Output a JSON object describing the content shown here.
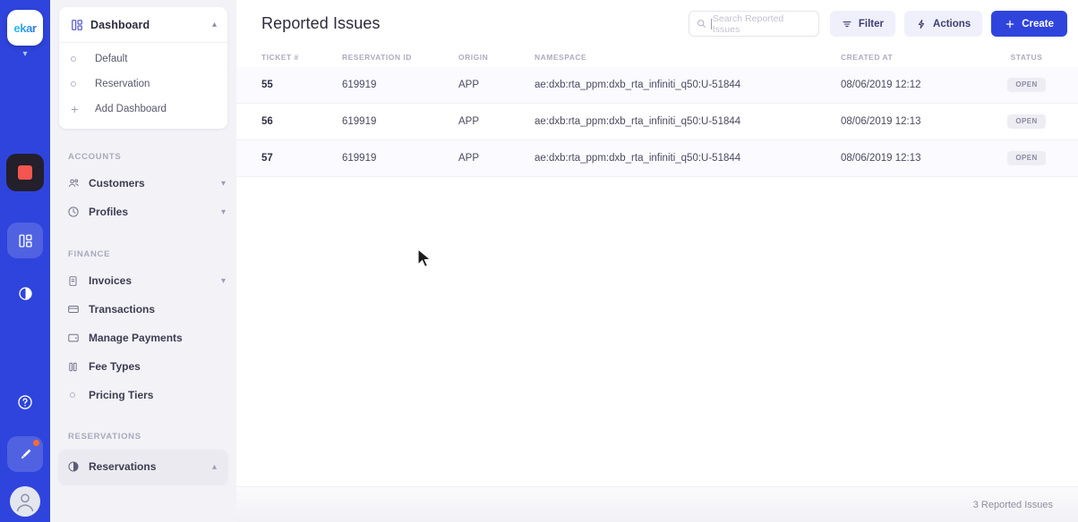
{
  "brand": {
    "name": "ekar",
    "accent": "#2f44dd",
    "rail_bg": "#2f44dd"
  },
  "rail": {
    "items": [
      {
        "name": "logo",
        "label": "ekar"
      },
      {
        "name": "recording-stop",
        "label": ""
      },
      {
        "name": "dashboard",
        "label": ""
      },
      {
        "name": "globe",
        "label": ""
      },
      {
        "name": "help",
        "label": ""
      },
      {
        "name": "theme-brush",
        "label": ""
      },
      {
        "name": "avatar",
        "label": ""
      }
    ]
  },
  "sidebar": {
    "dashboard": {
      "label": "Dashboard",
      "icon": "dashboard-icon",
      "expanded": true,
      "children": [
        {
          "label": "Default",
          "icon": "dot-icon"
        },
        {
          "label": "Reservation",
          "icon": "dot-icon"
        },
        {
          "label": "Add Dashboard",
          "icon": "plus-icon"
        }
      ]
    },
    "sections": [
      {
        "title": "ACCOUNTS",
        "items": [
          {
            "label": "Customers",
            "icon": "users-icon",
            "chevron": "down"
          },
          {
            "label": "Profiles",
            "icon": "clock-icon",
            "chevron": "down"
          }
        ]
      },
      {
        "title": "FINANCE",
        "items": [
          {
            "label": "Invoices",
            "icon": "document-icon",
            "chevron": "down"
          },
          {
            "label": "Transactions",
            "icon": "card-icon",
            "chevron": ""
          },
          {
            "label": "Manage Payments",
            "icon": "wallet-icon",
            "chevron": ""
          },
          {
            "label": "Fee Types",
            "icon": "bars-icon",
            "chevron": ""
          },
          {
            "label": "Pricing Tiers",
            "icon": "dot-icon",
            "chevron": ""
          }
        ]
      },
      {
        "title": "RESERVATIONS",
        "items": [
          {
            "label": "Reservations",
            "icon": "globe-icon",
            "chevron": "up",
            "active": true
          }
        ]
      }
    ]
  },
  "header": {
    "title": "Reported Issues",
    "search": {
      "value": "",
      "placeholder": "Search Reported Issues",
      "icon": "search-icon"
    },
    "buttons": [
      {
        "label": "Filter",
        "icon": "filter-icon",
        "style": "secondary"
      },
      {
        "label": "Actions",
        "icon": "lightning-icon",
        "style": "secondary"
      },
      {
        "label": "Create",
        "icon": "plus-icon",
        "style": "primary"
      }
    ]
  },
  "table": {
    "columns": [
      "TICKET #",
      "RESERVATION ID",
      "ORIGIN",
      "NAMESPACE",
      "CREATED AT",
      "STATUS"
    ],
    "rows": [
      {
        "ticket": "55",
        "reservation_id": "619919",
        "origin": "APP",
        "namespace": "ae:dxb:rta_ppm:dxb_rta_infiniti_q50:U-51844",
        "created_at": "08/06/2019 12:12",
        "status": "OPEN"
      },
      {
        "ticket": "56",
        "reservation_id": "619919",
        "origin": "APP",
        "namespace": "ae:dxb:rta_ppm:dxb_rta_infiniti_q50:U-51844",
        "created_at": "08/06/2019 12:13",
        "status": "OPEN"
      },
      {
        "ticket": "57",
        "reservation_id": "619919",
        "origin": "APP",
        "namespace": "ae:dxb:rta_ppm:dxb_rta_infiniti_q50:U-51844",
        "created_at": "08/06/2019 12:13",
        "status": "OPEN"
      }
    ]
  },
  "footer": {
    "count_label": "3 Reported Issues"
  }
}
